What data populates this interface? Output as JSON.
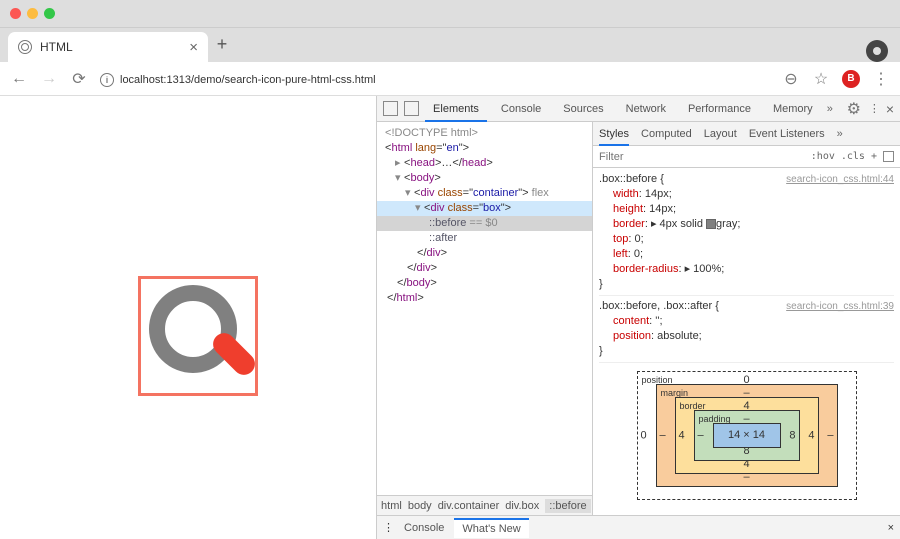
{
  "browser": {
    "tab_title": "HTML",
    "url": "localhost:1313/demo/search-icon-pure-html-css.html"
  },
  "devtools": {
    "main_tabs": [
      "Elements",
      "Console",
      "Sources",
      "Network",
      "Performance",
      "Memory"
    ],
    "active_main_tab": "Elements",
    "dom": {
      "doctype": "<!DOCTYPE html>",
      "html_open": "<html lang=\"en\">",
      "head": "<head>…</head>",
      "body_open": "<body>",
      "container": "div class=\"container\"",
      "container_hint": "flex",
      "box": "div class=\"box\"",
      "before": "::before",
      "before_dims": "== $0",
      "after": "::after",
      "div_close": "</div>",
      "body_close": "</body>",
      "html_close": "</html>"
    },
    "breadcrumb": [
      "html",
      "body",
      "div.container",
      "div.box",
      "::before"
    ],
    "styles_tabs": [
      "Styles",
      "Computed",
      "Layout",
      "Event Listeners"
    ],
    "active_styles_tab": "Styles",
    "filter_placeholder": "Filter",
    "filter_pills": [
      ":hov",
      ".cls",
      "+"
    ],
    "rule1": {
      "selector": ".box::before {",
      "source": "search-icon_css.html:44",
      "props": [
        {
          "n": "width",
          "v": "14px;"
        },
        {
          "n": "height",
          "v": "14px;"
        },
        {
          "n": "border",
          "v": "▸ 4px solid ",
          "swatch": true,
          "v2": "gray;"
        },
        {
          "n": "top",
          "v": "0;"
        },
        {
          "n": "left",
          "v": "0;"
        },
        {
          "n": "border-radius",
          "v": "▸ 100%;"
        }
      ],
      "close": "}"
    },
    "rule2": {
      "selector": ".box::before, .box::after {",
      "source": "search-icon_css.html:39",
      "props": [
        {
          "n": "content",
          "v": "'';"
        },
        {
          "n": "position",
          "v": "absolute;"
        }
      ],
      "close": "}"
    },
    "box_model": {
      "position": {
        "label": "position",
        "t": "0",
        "r": "",
        "b": "",
        "l": "0"
      },
      "margin": {
        "label": "margin",
        "t": "–",
        "r": "–",
        "b": "–",
        "l": "–"
      },
      "border": {
        "label": "border",
        "t": "4",
        "r": "4",
        "b": "4",
        "l": "4"
      },
      "padding": {
        "label": "padding",
        "t": "–",
        "r": "8",
        "b": "8",
        "l": "–"
      },
      "content": "14 × 14"
    },
    "drawer_tabs": [
      "Console",
      "What's New"
    ],
    "active_drawer_tab": "What's New"
  }
}
